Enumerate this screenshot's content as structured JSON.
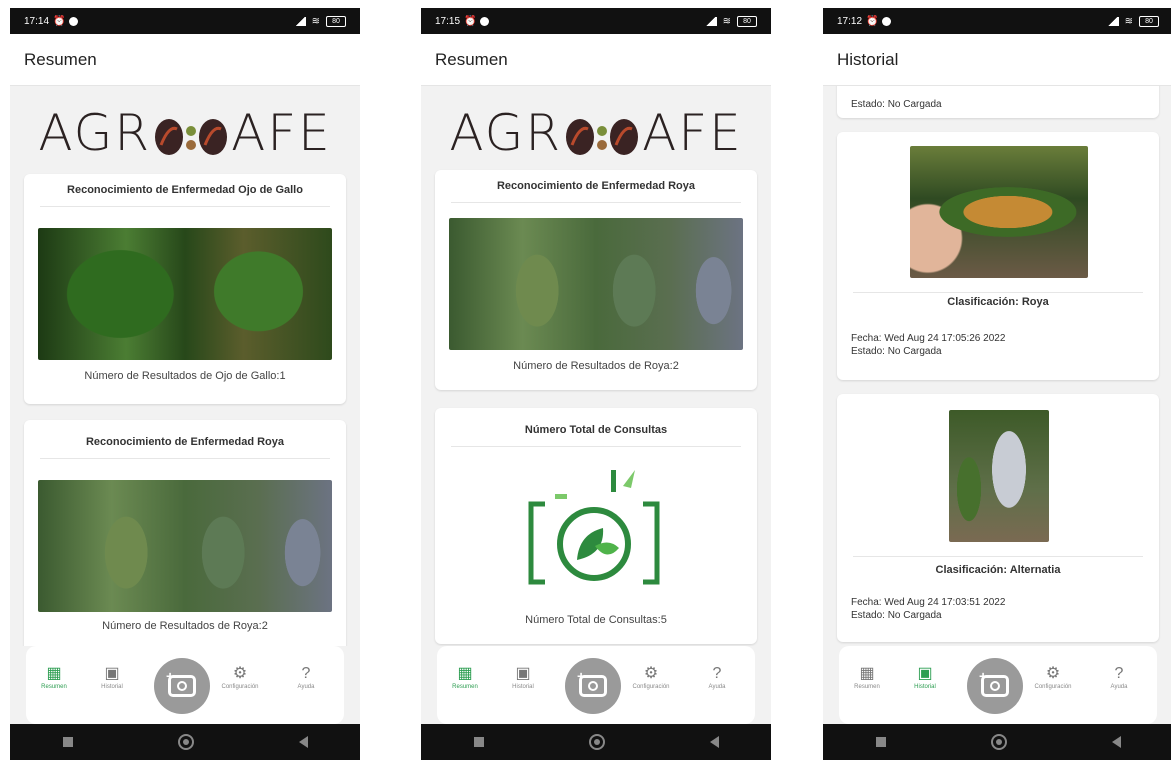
{
  "status": {
    "time1": "17:14",
    "time2": "17:15",
    "time3": "17:12",
    "battery": "80"
  },
  "screen1": {
    "title": "Resumen",
    "logo_text_left": "AGR",
    "logo_text_right": "AFE",
    "card1_title": "Reconocimiento de Enfermedad Ojo de Gallo",
    "card1_caption": "Número de Resultados de Ojo de Gallo:1",
    "card2_title": "Reconocimiento de Enfermedad Roya",
    "card2_caption": "Número de Resultados de Roya:2"
  },
  "screen2": {
    "title": "Resumen",
    "card1_title": "Reconocimiento de Enfermedad Roya",
    "card1_caption": "Número de Resultados de Roya:2",
    "card2_title": "Número Total de Consultas",
    "card2_caption": "Número Total de Consultas:5"
  },
  "screen3": {
    "title": "Historial",
    "top_state": "Estado: No Cargada",
    "item1_class": "Clasificación: Roya",
    "item1_date": "Fecha: Wed Aug 24 17:05:26 2022",
    "item1_state": "Estado: No Cargada",
    "item2_class": "Clasificación: Alternatia",
    "item2_date": "Fecha: Wed Aug 24 17:03:51 2022",
    "item2_state": "Estado: No Cargada"
  },
  "nav": {
    "resumen": "Resumen",
    "historial": "Historial",
    "configuracion": "Configuración",
    "ayuda": "Ayuda"
  },
  "colors": {
    "accent": "#2e9e52",
    "fab": "#9a9a9a"
  }
}
